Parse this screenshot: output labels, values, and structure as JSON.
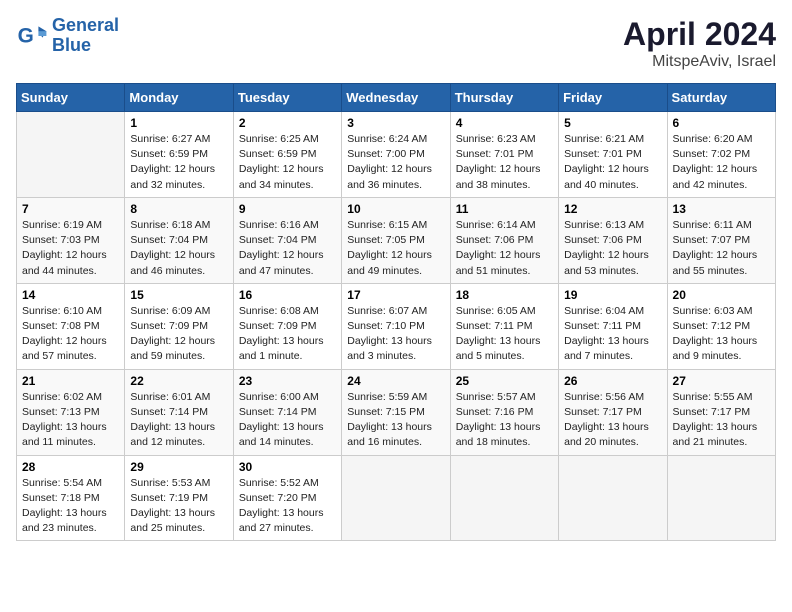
{
  "header": {
    "logo_line1": "General",
    "logo_line2": "Blue",
    "title": "April 2024",
    "subtitle": "MitspeAviv, Israel"
  },
  "weekdays": [
    "Sunday",
    "Monday",
    "Tuesday",
    "Wednesday",
    "Thursday",
    "Friday",
    "Saturday"
  ],
  "weeks": [
    [
      {
        "day": "",
        "info": ""
      },
      {
        "day": "1",
        "info": "Sunrise: 6:27 AM\nSunset: 6:59 PM\nDaylight: 12 hours\nand 32 minutes."
      },
      {
        "day": "2",
        "info": "Sunrise: 6:25 AM\nSunset: 6:59 PM\nDaylight: 12 hours\nand 34 minutes."
      },
      {
        "day": "3",
        "info": "Sunrise: 6:24 AM\nSunset: 7:00 PM\nDaylight: 12 hours\nand 36 minutes."
      },
      {
        "day": "4",
        "info": "Sunrise: 6:23 AM\nSunset: 7:01 PM\nDaylight: 12 hours\nand 38 minutes."
      },
      {
        "day": "5",
        "info": "Sunrise: 6:21 AM\nSunset: 7:01 PM\nDaylight: 12 hours\nand 40 minutes."
      },
      {
        "day": "6",
        "info": "Sunrise: 6:20 AM\nSunset: 7:02 PM\nDaylight: 12 hours\nand 42 minutes."
      }
    ],
    [
      {
        "day": "7",
        "info": "Sunrise: 6:19 AM\nSunset: 7:03 PM\nDaylight: 12 hours\nand 44 minutes."
      },
      {
        "day": "8",
        "info": "Sunrise: 6:18 AM\nSunset: 7:04 PM\nDaylight: 12 hours\nand 46 minutes."
      },
      {
        "day": "9",
        "info": "Sunrise: 6:16 AM\nSunset: 7:04 PM\nDaylight: 12 hours\nand 47 minutes."
      },
      {
        "day": "10",
        "info": "Sunrise: 6:15 AM\nSunset: 7:05 PM\nDaylight: 12 hours\nand 49 minutes."
      },
      {
        "day": "11",
        "info": "Sunrise: 6:14 AM\nSunset: 7:06 PM\nDaylight: 12 hours\nand 51 minutes."
      },
      {
        "day": "12",
        "info": "Sunrise: 6:13 AM\nSunset: 7:06 PM\nDaylight: 12 hours\nand 53 minutes."
      },
      {
        "day": "13",
        "info": "Sunrise: 6:11 AM\nSunset: 7:07 PM\nDaylight: 12 hours\nand 55 minutes."
      }
    ],
    [
      {
        "day": "14",
        "info": "Sunrise: 6:10 AM\nSunset: 7:08 PM\nDaylight: 12 hours\nand 57 minutes."
      },
      {
        "day": "15",
        "info": "Sunrise: 6:09 AM\nSunset: 7:09 PM\nDaylight: 12 hours\nand 59 minutes."
      },
      {
        "day": "16",
        "info": "Sunrise: 6:08 AM\nSunset: 7:09 PM\nDaylight: 13 hours\nand 1 minute."
      },
      {
        "day": "17",
        "info": "Sunrise: 6:07 AM\nSunset: 7:10 PM\nDaylight: 13 hours\nand 3 minutes."
      },
      {
        "day": "18",
        "info": "Sunrise: 6:05 AM\nSunset: 7:11 PM\nDaylight: 13 hours\nand 5 minutes."
      },
      {
        "day": "19",
        "info": "Sunrise: 6:04 AM\nSunset: 7:11 PM\nDaylight: 13 hours\nand 7 minutes."
      },
      {
        "day": "20",
        "info": "Sunrise: 6:03 AM\nSunset: 7:12 PM\nDaylight: 13 hours\nand 9 minutes."
      }
    ],
    [
      {
        "day": "21",
        "info": "Sunrise: 6:02 AM\nSunset: 7:13 PM\nDaylight: 13 hours\nand 11 minutes."
      },
      {
        "day": "22",
        "info": "Sunrise: 6:01 AM\nSunset: 7:14 PM\nDaylight: 13 hours\nand 12 minutes."
      },
      {
        "day": "23",
        "info": "Sunrise: 6:00 AM\nSunset: 7:14 PM\nDaylight: 13 hours\nand 14 minutes."
      },
      {
        "day": "24",
        "info": "Sunrise: 5:59 AM\nSunset: 7:15 PM\nDaylight: 13 hours\nand 16 minutes."
      },
      {
        "day": "25",
        "info": "Sunrise: 5:57 AM\nSunset: 7:16 PM\nDaylight: 13 hours\nand 18 minutes."
      },
      {
        "day": "26",
        "info": "Sunrise: 5:56 AM\nSunset: 7:17 PM\nDaylight: 13 hours\nand 20 minutes."
      },
      {
        "day": "27",
        "info": "Sunrise: 5:55 AM\nSunset: 7:17 PM\nDaylight: 13 hours\nand 21 minutes."
      }
    ],
    [
      {
        "day": "28",
        "info": "Sunrise: 5:54 AM\nSunset: 7:18 PM\nDaylight: 13 hours\nand 23 minutes."
      },
      {
        "day": "29",
        "info": "Sunrise: 5:53 AM\nSunset: 7:19 PM\nDaylight: 13 hours\nand 25 minutes."
      },
      {
        "day": "30",
        "info": "Sunrise: 5:52 AM\nSunset: 7:20 PM\nDaylight: 13 hours\nand 27 minutes."
      },
      {
        "day": "",
        "info": ""
      },
      {
        "day": "",
        "info": ""
      },
      {
        "day": "",
        "info": ""
      },
      {
        "day": "",
        "info": ""
      }
    ]
  ]
}
